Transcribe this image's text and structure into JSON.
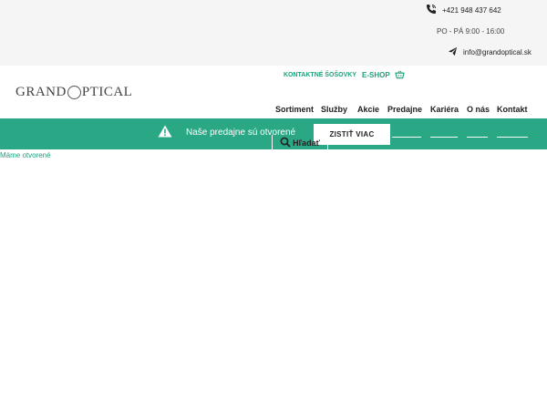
{
  "contact": {
    "phone": "+421 948 437 642",
    "hours": "PO - PÁ 9:00 - 16:00",
    "email": "info@grandoptical.sk",
    "phone_icon": "phone-icon",
    "email_icon": "paper-plane-icon"
  },
  "logo": {
    "text_left": "GRAND",
    "text_right": "PTICAL"
  },
  "shop": {
    "lenses_label": "KONTAKTNÉ ŠOŠOVKY",
    "eshop_label": "E-SHOP",
    "cart_icon": "basket-icon"
  },
  "nav": {
    "items": [
      "Sortiment",
      "Služby",
      "Akcie",
      "Predajne",
      "Kariéra",
      "O nás",
      "Kontakt"
    ]
  },
  "banner": {
    "message": "Naše predajne sú otvorené",
    "button_label": "ZISTIŤ VIAC",
    "icon": "warning-icon"
  },
  "search": {
    "label": "Hľadať",
    "icon": "search-icon"
  },
  "status_link": "Máme otvorené",
  "colors": {
    "brand_green": "#2aa784",
    "link_green": "#1aa27d",
    "topbar_bg": "#f5f5f5"
  }
}
